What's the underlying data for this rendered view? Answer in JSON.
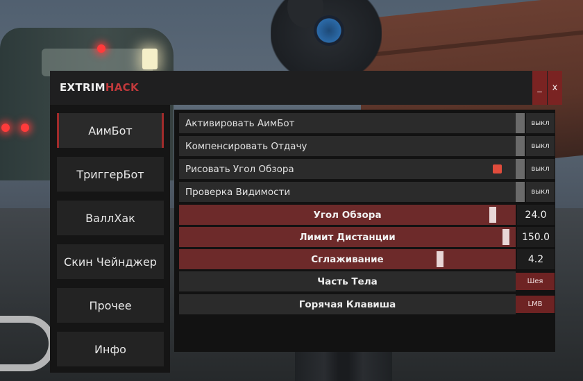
{
  "window": {
    "title_main": "EXTRIM",
    "title_accent": "HACK",
    "minimize_label": "_",
    "close_label": "x",
    "accent_color": "#c0393b"
  },
  "sidebar": {
    "items": [
      {
        "label": "АимБот",
        "active": true
      },
      {
        "label": "ТриггерБот",
        "active": false
      },
      {
        "label": "ВаллХак",
        "active": false
      },
      {
        "label": "Скин Чейнджер",
        "active": false
      },
      {
        "label": "Прочее",
        "active": false
      },
      {
        "label": "Инфо",
        "active": false
      }
    ]
  },
  "toggles": [
    {
      "label": "Активировать АимБот",
      "state": "выкл"
    },
    {
      "label": "Компенсировать Отдачу",
      "state": "выкл"
    },
    {
      "label": "Рисовать Угол Обзора",
      "state": "выкл",
      "color": "#e14c3c"
    },
    {
      "label": "Проверка Видимости",
      "state": "выкл"
    }
  ],
  "sliders": [
    {
      "label": "Угол Обзора",
      "value": "24.0",
      "fraction": 0.94
    },
    {
      "label": "Лимит Дистанции",
      "value": "150.0",
      "fraction": 0.98
    },
    {
      "label": "Сглаживание",
      "value": "4.2",
      "fraction": 0.78
    }
  ],
  "selectors": [
    {
      "label": "Часть Тела",
      "value": "Шея"
    },
    {
      "label": "Горячая Клавиша",
      "value": "LMB"
    }
  ]
}
